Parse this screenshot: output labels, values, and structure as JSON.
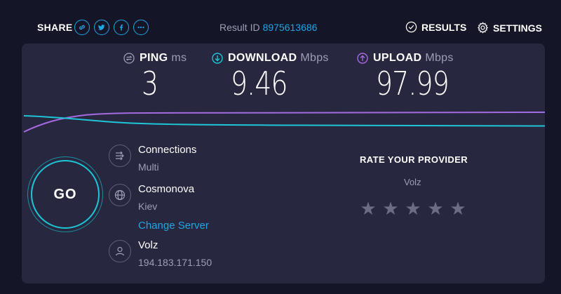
{
  "header": {
    "share_label": "SHARE",
    "share_icons": [
      "link-icon",
      "twitter-icon",
      "facebook-icon",
      "more-icon"
    ],
    "result_id_label": "Result ID",
    "result_id_value": "8975613686",
    "results_label": "RESULTS",
    "settings_label": "SETTINGS"
  },
  "metrics": {
    "ping": {
      "label": "PING",
      "unit": "ms",
      "value": "3"
    },
    "download": {
      "label": "DOWNLOAD",
      "unit": "Mbps",
      "value": "9.46"
    },
    "upload": {
      "label": "UPLOAD",
      "unit": "Mbps",
      "value": "97.99"
    }
  },
  "go_label": "GO",
  "connections": {
    "title": "Connections",
    "value": "Multi"
  },
  "server": {
    "name": "Cosmonova",
    "location": "Kiev",
    "change_label": "Change Server"
  },
  "provider": {
    "name": "Volz",
    "ip": "194.183.171.150"
  },
  "rating": {
    "title": "RATE YOUR PROVIDER",
    "provider": "Volz",
    "stars": 5
  },
  "colors": {
    "background": "#141526",
    "panel": "#27283f",
    "accent_blue": "#1ea6e6",
    "download": "#1ec5d6",
    "upload": "#a46ae0",
    "muted": "#9d9eb7"
  }
}
